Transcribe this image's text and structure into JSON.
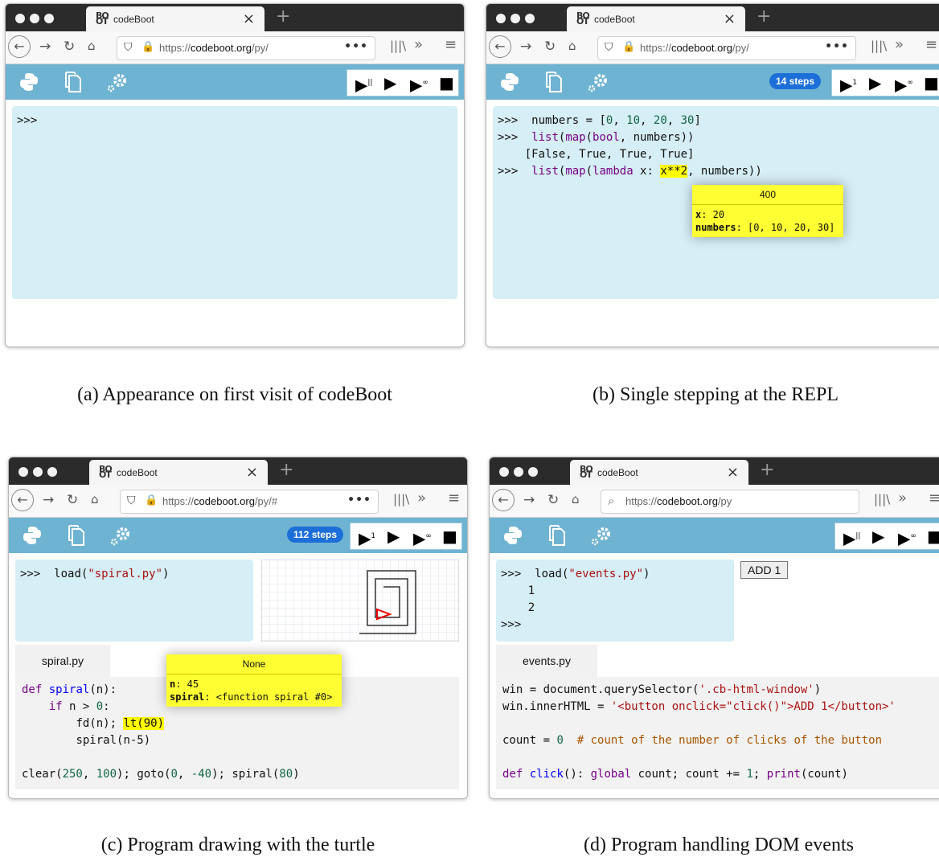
{
  "browser": {
    "tab_title": "codeBoot",
    "tab_logo": "BO\nOT",
    "close_glyph": "×",
    "newtab_glyph": "+",
    "url_plain": "https://",
    "url_host": "codeboot.org",
    "url_dots": "•••",
    "library_glyph": "|||\\",
    "overflow_glyph": "»",
    "menu_glyph": "≡",
    "controls": {
      "step_one": "▶",
      "step_one_sup": "1",
      "step_double_sup": "||",
      "play": "▶",
      "anim": "▶",
      "anim_sup": "∞",
      "stop": "■"
    }
  },
  "panels": {
    "a": {
      "url_path": "/py/",
      "repl_prompt": ">>>",
      "caption": "(a) Appearance on first visit of codeBoot"
    },
    "b": {
      "url_path": "/py/",
      "steps": "14 steps",
      "repl": {
        "prompt": ">>>",
        "l1": "numbers = [",
        "l1_n0": "0",
        "l1_c1": ", ",
        "l1_n1": "10",
        "l1_c2": ", ",
        "l1_n2": "20",
        "l1_c3": ", ",
        "l1_n3": "30",
        "l1_end": "]",
        "l2_list": "list",
        "l2_map": "map",
        "l2_bool": "bool",
        "l2_rest": "numbers))",
        "l3": "[False, True, True, True]",
        "l4_list": "list",
        "l4_map": "map",
        "l4_lambda": "lambda",
        "l4_x": " x: ",
        "l4_hl": "x**2",
        "l4_rest": ", numbers))"
      },
      "popup": {
        "title": "400",
        "v1_name": "x",
        "v1_val": ": 20",
        "v2_name": "numbers",
        "v2_val": ": [0, 10, 20, 30]"
      },
      "caption": "(b) Single stepping at the REPL"
    },
    "c": {
      "url_path": "/py/#",
      "steps": "112 steps",
      "repl": {
        "prompt": ">>>",
        "cmd": "load(",
        "arg": "\"spiral.py\"",
        "close": ")"
      },
      "editor_tab": "spiral.py",
      "editor": {
        "def": "def",
        "fname": "spiral",
        "sig": "(n):",
        "if": "if",
        "cond": " n > ",
        "zero": "0",
        "colon": ":",
        "fd": "fd(n); ",
        "lt_hl": "lt(90)",
        "rec": "spiral(n-5)",
        "last_a": "clear(",
        "n250": "250",
        "c1": ", ",
        "n100": "100",
        "last_b": "); goto(",
        "n0": "0",
        "c2": ", ",
        "nm40": "-40",
        "last_c": "); spiral(",
        "n80": "80",
        "last_d": ")"
      },
      "popup": {
        "title": "None",
        "v1_name": "n",
        "v1_val": ": 45",
        "v2_name": "spiral",
        "v2_val": ": <function spiral #0>"
      },
      "caption": "(c) Program drawing with the turtle"
    },
    "d": {
      "url_path": "/py",
      "repl": {
        "prompt": ">>>",
        "cmd": "load(",
        "arg": "\"events.py\"",
        "close": ")",
        "out1": "1",
        "out2": "2"
      },
      "add_button": "ADD 1",
      "editor_tab": "events.py",
      "editor": {
        "l1": "win = document.querySelector(",
        "l1_str": "'.cb-html-window'",
        "l1_end": ")",
        "l2": "win.innerHTML = ",
        "l2_str": "'<button onclick=\"click()\">ADD 1</button>'",
        "l3": "count = ",
        "l3_num": "0",
        "l3_cmt": "  # count of the number of clicks of the button",
        "l4_def": "def",
        "l4_fn": "click",
        "l4_a": "(): ",
        "l4_global": "global",
        "l4_b": " count; count += ",
        "l4_one": "1",
        "l4_c": "; ",
        "l4_print": "print",
        "l4_d": "(count)"
      },
      "caption": "(d) Program handling DOM events"
    }
  }
}
